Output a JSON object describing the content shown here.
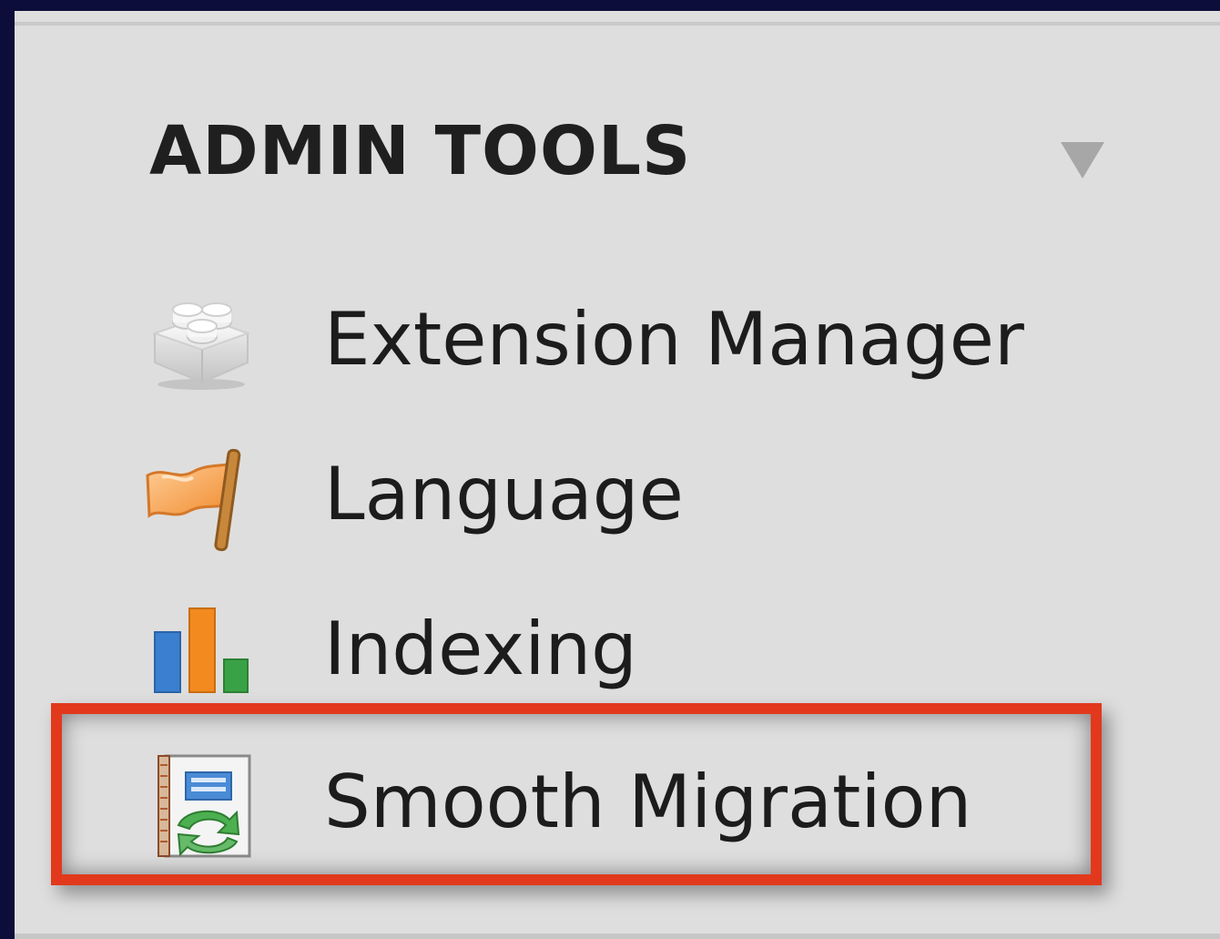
{
  "panel": {
    "title": "ADMIN TOOLS",
    "collapse_icon": "triangle-down-icon"
  },
  "menu": {
    "items": [
      {
        "label": "Extension Manager",
        "icon": "lego-brick-icon"
      },
      {
        "label": "Language",
        "icon": "flag-icon"
      },
      {
        "label": "Indexing",
        "icon": "bar-chart-icon"
      },
      {
        "label": "Smooth Migration",
        "icon": "migration-notebook-icon",
        "highlighted": true
      }
    ]
  },
  "colors": {
    "background": "#0c0d3a",
    "panel": "#dedede",
    "highlight_border": "#e2391d",
    "text": "#1c1c1c"
  }
}
